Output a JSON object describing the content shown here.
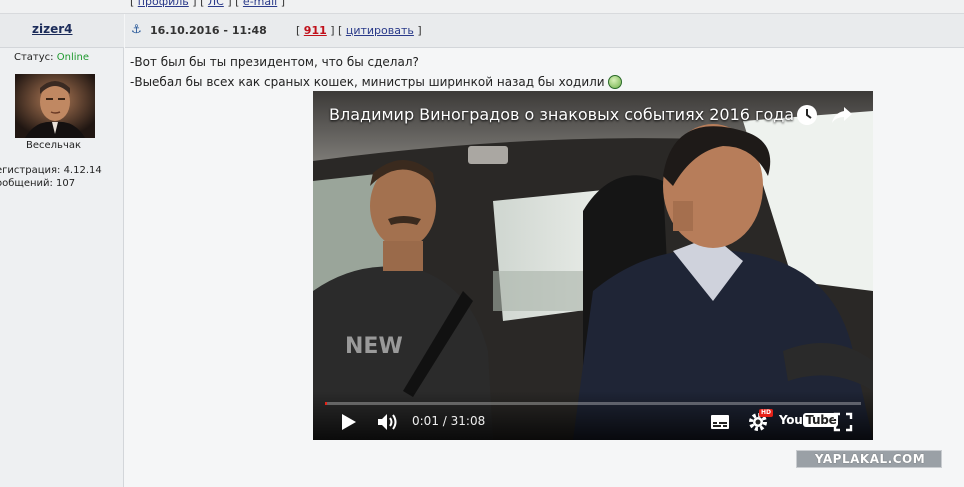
{
  "top_strip": {
    "open": "[",
    "link1": "профиль",
    "sep1": "] [",
    "link2": "ЛС",
    "sep2": "] [",
    "link3": "e-mail",
    "close": "]"
  },
  "user": {
    "username": "zizer4",
    "status_label": "Статус:",
    "status_value": "Online",
    "rank": "Весельчак",
    "registration": "егистрация: 4.12.14",
    "messages": "ообщений: 107"
  },
  "post": {
    "date": "16.10.2016 - 11:48",
    "action_open": "[",
    "post_number": "911",
    "action_sep": "] [",
    "quote_label": "цитировать",
    "action_close": "]",
    "line1": "-Вот был бы ты президентом, что бы сделал?",
    "line2": "-Выебал бы всех как сраных кошек, министры ширинкой назад бы ходили"
  },
  "video": {
    "title": "Владимир Виноградов о знаковых событиях 2016 года",
    "time_current": "0:01",
    "time_sep": " / ",
    "time_total": "31:08",
    "progress": 0.0005,
    "logo_you": "You",
    "logo_tube": "Tube",
    "hd_label": "HD",
    "shirt_text": "NEW"
  },
  "watermark": "YAPLAKAL.COM",
  "icons": {
    "anchor": "anchor-icon",
    "smiley": "smiley-icon",
    "clock": "watch-later-icon",
    "share": "share-icon",
    "play": "play-icon",
    "volume": "volume-icon",
    "cc": "subtitles-icon",
    "settings": "gear-icon",
    "fullscreen": "fullscreen-icon"
  },
  "colors": {
    "online": "#1f9a2f",
    "post_number": "#c0101a",
    "link": "#2a3a8a",
    "progress": "#e62117"
  }
}
